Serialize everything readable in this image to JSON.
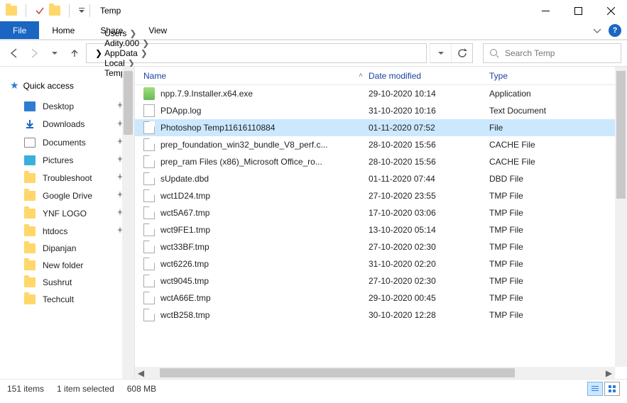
{
  "window": {
    "title": "Temp"
  },
  "ribbon": {
    "file": "File",
    "tabs": [
      "Home",
      "Share",
      "View"
    ]
  },
  "breadcrumb": [
    "Users",
    "Adity.000",
    "AppData",
    "Local",
    "Temp"
  ],
  "search": {
    "placeholder": "Search Temp"
  },
  "nav": {
    "quick_access": "Quick access",
    "items": [
      {
        "label": "Desktop",
        "icon": "desktop",
        "pinned": true
      },
      {
        "label": "Downloads",
        "icon": "downloads",
        "pinned": true
      },
      {
        "label": "Documents",
        "icon": "documents",
        "pinned": true
      },
      {
        "label": "Pictures",
        "icon": "pictures",
        "pinned": true
      },
      {
        "label": "Troubleshoot",
        "icon": "folder",
        "pinned": true
      },
      {
        "label": "Google Drive",
        "icon": "folder",
        "pinned": true
      },
      {
        "label": "YNF LOGO",
        "icon": "folder",
        "pinned": true
      },
      {
        "label": "htdocs",
        "icon": "folder",
        "pinned": true
      },
      {
        "label": "Dipanjan",
        "icon": "folder",
        "pinned": false
      },
      {
        "label": "New folder",
        "icon": "folder",
        "pinned": false
      },
      {
        "label": "Sushrut",
        "icon": "folder",
        "pinned": false
      },
      {
        "label": "Techcult",
        "icon": "folder",
        "pinned": false
      }
    ]
  },
  "columns": {
    "name": "Name",
    "date": "Date modified",
    "type": "Type"
  },
  "files": [
    {
      "name": "npp.7.9.Installer.x64.exe",
      "date": "29-10-2020 10:14",
      "type": "Application",
      "icon": "app",
      "selected": false
    },
    {
      "name": "PDApp.log",
      "date": "31-10-2020 10:16",
      "type": "Text Document",
      "icon": "txt",
      "selected": false
    },
    {
      "name": "Photoshop Temp11616110884",
      "date": "01-11-2020 07:52",
      "type": "File",
      "icon": "file",
      "selected": true
    },
    {
      "name": "prep_foundation_win32_bundle_V8_perf.c...",
      "date": "28-10-2020 15:56",
      "type": "CACHE File",
      "icon": "file",
      "selected": false
    },
    {
      "name": "prep_ram Files (x86)_Microsoft Office_ro...",
      "date": "28-10-2020 15:56",
      "type": "CACHE File",
      "icon": "file",
      "selected": false
    },
    {
      "name": "sUpdate.dbd",
      "date": "01-11-2020 07:44",
      "type": "DBD File",
      "icon": "file",
      "selected": false
    },
    {
      "name": "wct1D24.tmp",
      "date": "27-10-2020 23:55",
      "type": "TMP File",
      "icon": "file",
      "selected": false
    },
    {
      "name": "wct5A67.tmp",
      "date": "17-10-2020 03:06",
      "type": "TMP File",
      "icon": "file",
      "selected": false
    },
    {
      "name": "wct9FE1.tmp",
      "date": "13-10-2020 05:14",
      "type": "TMP File",
      "icon": "file",
      "selected": false
    },
    {
      "name": "wct33BF.tmp",
      "date": "27-10-2020 02:30",
      "type": "TMP File",
      "icon": "file",
      "selected": false
    },
    {
      "name": "wct6226.tmp",
      "date": "31-10-2020 02:20",
      "type": "TMP File",
      "icon": "file",
      "selected": false
    },
    {
      "name": "wct9045.tmp",
      "date": "27-10-2020 02:30",
      "type": "TMP File",
      "icon": "file",
      "selected": false
    },
    {
      "name": "wctA66E.tmp",
      "date": "29-10-2020 00:45",
      "type": "TMP File",
      "icon": "file",
      "selected": false
    },
    {
      "name": "wctB258.tmp",
      "date": "30-10-2020 12:28",
      "type": "TMP File",
      "icon": "file",
      "selected": false
    }
  ],
  "status": {
    "count": "151 items",
    "selection": "1 item selected",
    "size": "608 MB"
  }
}
